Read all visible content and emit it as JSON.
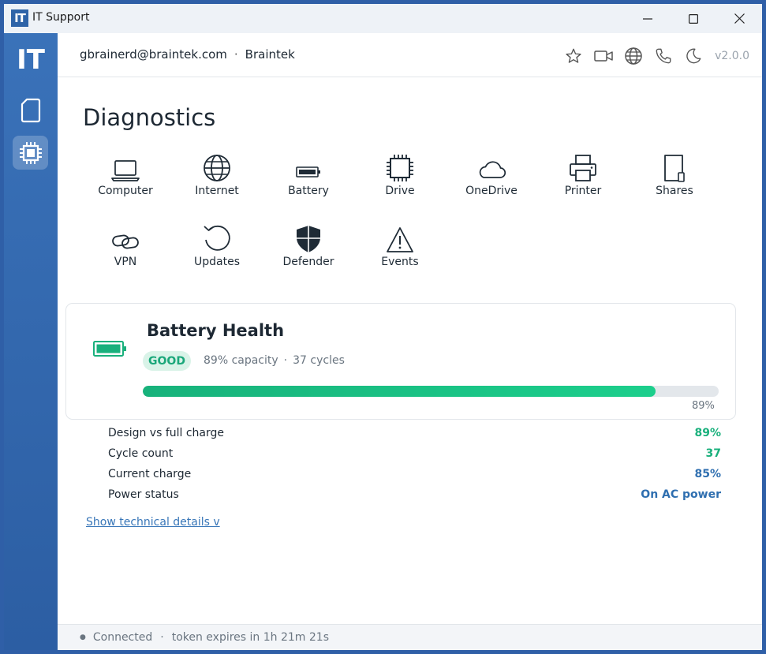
{
  "window": {
    "app_logo": "IT",
    "title": "IT Support"
  },
  "sidebar": {
    "logo": "IT",
    "items": [
      {
        "name": "tablet-icon"
      },
      {
        "name": "chip-icon",
        "active": true
      }
    ]
  },
  "header": {
    "email": "gbrainerd@braintek.com",
    "separator": "·",
    "company": "Braintek",
    "icons": [
      "star-icon",
      "video-icon",
      "globe-icon",
      "phone-icon",
      "moon-icon"
    ],
    "version": "v2.0.0"
  },
  "main": {
    "title": "Diagnostics",
    "tiles": [
      {
        "label": "Computer",
        "icon": "laptop-icon"
      },
      {
        "label": "Internet",
        "icon": "globe-icon"
      },
      {
        "label": "Battery",
        "icon": "battery-icon"
      },
      {
        "label": "Drive",
        "icon": "chip-icon"
      },
      {
        "label": "OneDrive",
        "icon": "cloud-icon"
      },
      {
        "label": "Printer",
        "icon": "printer-icon"
      },
      {
        "label": "Shares",
        "icon": "file-icon"
      },
      {
        "label": "VPN",
        "icon": "link-icon"
      },
      {
        "label": "Updates",
        "icon": "refresh-icon"
      },
      {
        "label": "Defender",
        "icon": "shield-icon"
      },
      {
        "label": "Events",
        "icon": "warning-icon"
      }
    ]
  },
  "battery_card": {
    "title": "Battery Health",
    "badge": "GOOD",
    "capacity": "89% capacity",
    "dot": "·",
    "cycles": "37 cycles",
    "progress": 0.89,
    "progress_label": "89%",
    "colors": {
      "good": "#19b07c",
      "info": "#2f6fb0"
    }
  },
  "stats": [
    {
      "label": "Design vs full charge",
      "value": "89%",
      "color": "green"
    },
    {
      "label": "Cycle count",
      "value": "37",
      "color": "green"
    },
    {
      "label": "Current charge",
      "value": "85%",
      "color": "blue"
    },
    {
      "label": "Power status",
      "value": "On AC power",
      "color": "blue"
    }
  ],
  "details_link": "Show technical details v",
  "status": {
    "dot": "●",
    "connection": "Connected",
    "sep": "·",
    "token": "token expires in 1h 21m 21s"
  }
}
